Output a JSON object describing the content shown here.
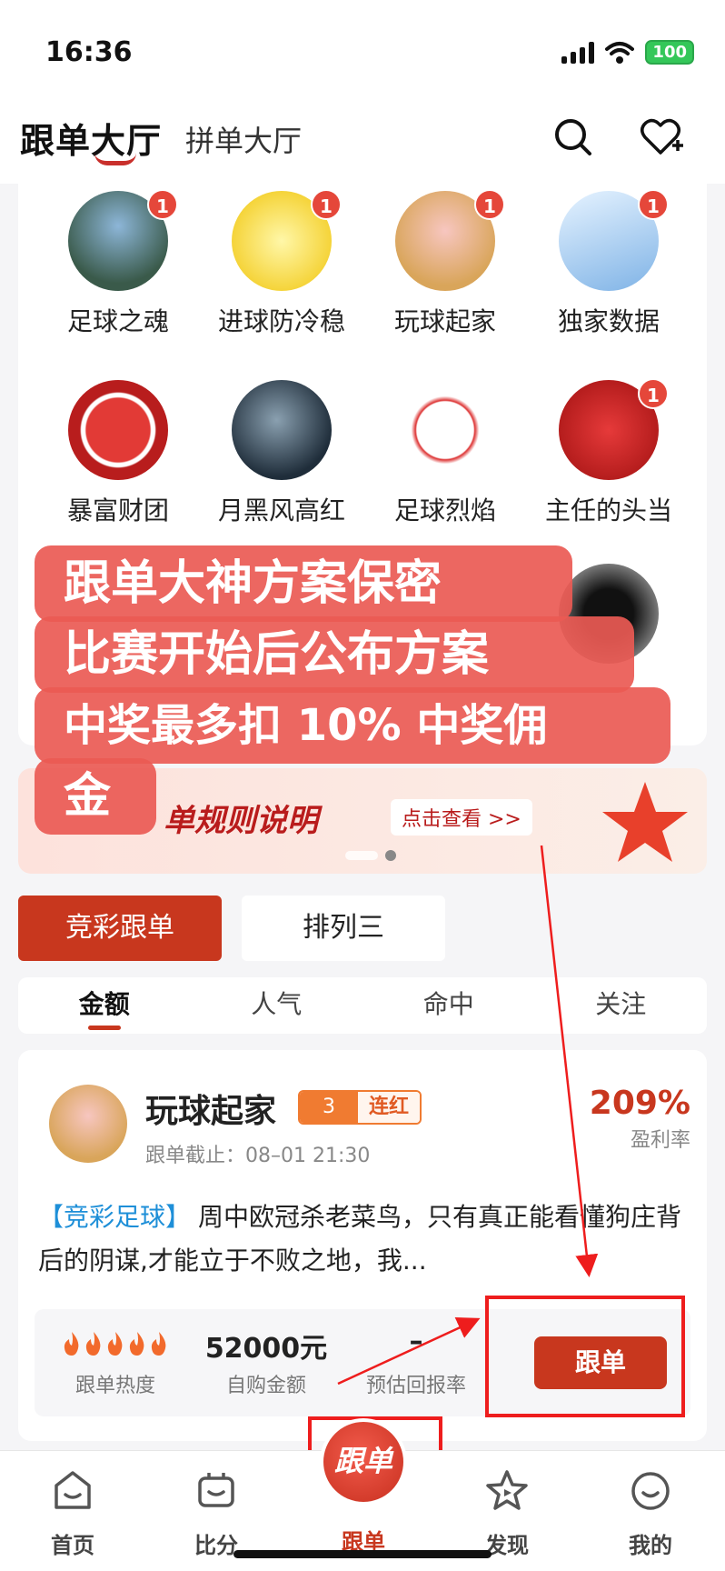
{
  "status": {
    "time": "16:36",
    "battery": "100"
  },
  "header": {
    "active_tab": "跟单大厅",
    "second_tab": "拼单大厅"
  },
  "experts": [
    {
      "name": "足球之魂",
      "badge": "1"
    },
    {
      "name": "进球防冷稳",
      "badge": "1"
    },
    {
      "name": "玩球起家",
      "badge": "1"
    },
    {
      "name": "独家数据",
      "badge": "1"
    },
    {
      "name": "暴富财团",
      "badge": ""
    },
    {
      "name": "月黑风高红",
      "badge": ""
    },
    {
      "name": "足球烈焰",
      "badge": ""
    },
    {
      "name": "主任的头当",
      "badge": "1"
    }
  ],
  "banner": {
    "title": "单规则说明",
    "button": "点击查看 >>"
  },
  "callout": {
    "line1": "跟单大神方案保密",
    "line2": "比赛开始后公布方案",
    "line3": "中奖最多扣 10% 中奖佣",
    "line4": "金"
  },
  "categories": {
    "active": "竞彩跟单",
    "inactive": "排列三"
  },
  "sort": {
    "amount": "金额",
    "popularity": "人气",
    "hit": "命中",
    "follow": "关注"
  },
  "plan": {
    "name": "玩球起家",
    "streak_count": "3",
    "streak_label": "连红",
    "deadline": "跟单截止：08–01 21:30",
    "roi_value": "209%",
    "roi_label": "盈利率",
    "tag": "【竞彩足球】",
    "text": "周中欧冠杀老菜鸟，只有真正能看懂狗庄背后的阴谋,才能立于不败之地，我...",
    "heat_label": "跟单热度",
    "amount_value": "52000元",
    "amount_label": "自购金额",
    "return_value": "–",
    "return_label": "预估回报率",
    "follow_button": "跟单"
  },
  "tabbar": {
    "home": "首页",
    "score": "比分",
    "center_icon": "跟单",
    "center": "跟单",
    "discover": "发现",
    "mine": "我的"
  },
  "colors": {
    "accent": "#c8371e",
    "callout": "#ea5a54",
    "annotation": "#ee1d1d"
  }
}
